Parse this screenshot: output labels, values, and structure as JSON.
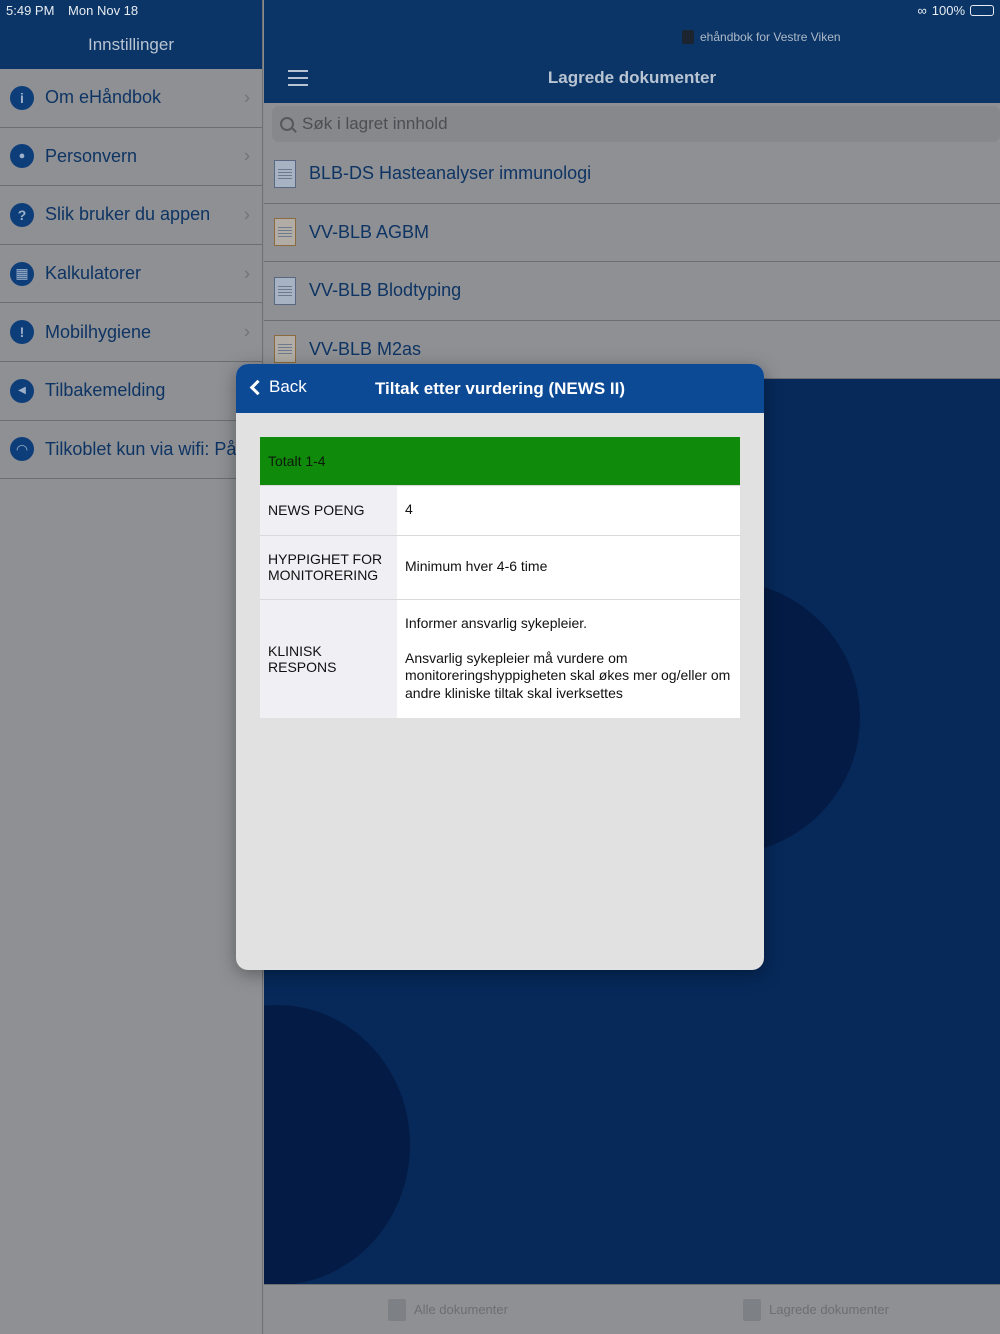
{
  "status_bar": {
    "time": "5:49 PM",
    "date": "Mon Nov 18",
    "battery": "100%"
  },
  "sidebar": {
    "title": "Innstillinger",
    "items": [
      {
        "label": "Om eHåndbok",
        "icon": "info-icon",
        "glyph": "i"
      },
      {
        "label": "Personvern",
        "icon": "lock-icon",
        "glyph": "🔒"
      },
      {
        "label": "Slik bruker du appen",
        "icon": "question-icon",
        "glyph": "?"
      },
      {
        "label": "Kalkulatorer",
        "icon": "calculator-icon",
        "glyph": "▦"
      },
      {
        "label": "Mobilhygiene",
        "icon": "exclamation-icon",
        "glyph": "!"
      },
      {
        "label": "Tilbakemelding",
        "icon": "speaker-icon",
        "glyph": "◀"
      },
      {
        "label": "Tilkoblet kun via wifi: På",
        "icon": "wifi-icon",
        "glyph": "◠"
      }
    ]
  },
  "header": {
    "brand": "ehåndbok for Vestre Viken",
    "title": "Lagrede dokumenter"
  },
  "search": {
    "placeholder": "Søk i lagret innhold"
  },
  "documents": [
    {
      "label": "BLB-DS Hasteanalyser immunologi"
    },
    {
      "label": "VV-BLB AGBM"
    },
    {
      "label": "VV-BLB Blodtyping"
    },
    {
      "label": "VV-BLB M2as"
    }
  ],
  "tabbar": {
    "all_docs": "Alle dokumenter",
    "saved_docs": "Lagrede dokumenter"
  },
  "modal": {
    "back_label": "Back",
    "title": "Tiltak etter vurdering (NEWS II)",
    "total_label": "Totalt 1-4",
    "total_color": "#108a0a",
    "rows": {
      "score_key": "NEWS POENG",
      "score_value": "4",
      "freq_key_line1": "HYPPIGHET FOR",
      "freq_key_line2": "MONITORERING",
      "freq_value": "Minimum hver 4-6 time",
      "response_key": "KLINISK RESPONS",
      "response_value_1": "Informer ansvarlig sykepleier.",
      "response_value_2": "Ansvarlig sykepleier må vurdere om monitoreringshyppigheten skal økes mer og/eller om andre kliniske tiltak skal iverksettes"
    }
  },
  "colors": {
    "nav": "#0a3566",
    "modal_header": "#0c4a96",
    "background": "#06295a"
  }
}
